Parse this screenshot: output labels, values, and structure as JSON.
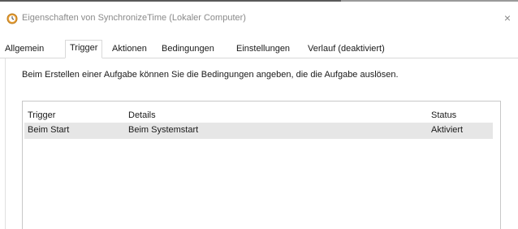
{
  "window": {
    "title": "Eigenschaften von SynchronizeTime (Lokaler Computer)",
    "close_glyph": "×",
    "icon": "task-scheduler-clock-icon"
  },
  "tabs": [
    {
      "label": "Allgemein",
      "active": false
    },
    {
      "label": "Trigger",
      "active": true
    },
    {
      "label": "Aktionen",
      "active": false
    },
    {
      "label": "Bedingungen",
      "active": false
    },
    {
      "label": "Einstellungen",
      "active": false
    },
    {
      "label": "Verlauf (deaktiviert)",
      "active": false
    }
  ],
  "trigger_tab": {
    "description": "Beim Erstellen einer Aufgabe können Sie die Bedingungen angeben, die die Aufgabe auslösen.",
    "columns": [
      "Trigger",
      "Details",
      "Status"
    ],
    "rows": [
      {
        "trigger": "Beim Start",
        "details": "Beim Systemstart",
        "status": "Aktiviert",
        "selected": true
      }
    ]
  },
  "colors": {
    "selected_row": "#e6e6e6",
    "border": "#c8c8c8",
    "title_text": "#8a8a8a"
  }
}
